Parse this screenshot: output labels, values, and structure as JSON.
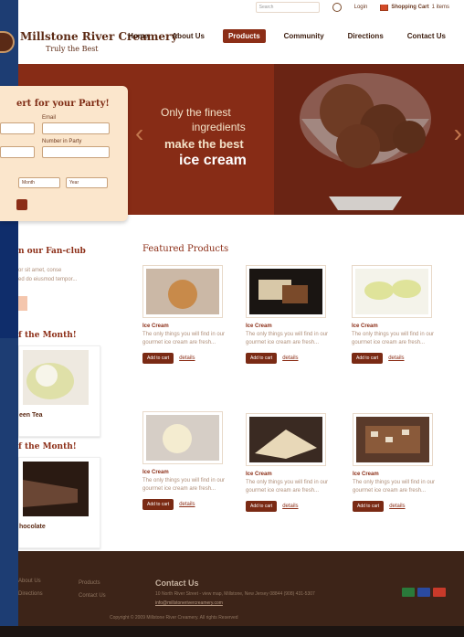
{
  "utility": {
    "search_placeholder": "Search",
    "login": "Login",
    "cart": "Shopping Cart",
    "cart_count": "1 items"
  },
  "header": {
    "brand": "Millstone River Creamery",
    "tagline": "Truly the Best",
    "nav": [
      "Home",
      "About Us",
      "Products",
      "Community",
      "Directions",
      "Contact Us"
    ],
    "active_nav": "Products"
  },
  "hero": {
    "line1": "Only the finest",
    "line2": "ingredients",
    "line3": "make the best",
    "line4": "ice cream"
  },
  "reservation": {
    "title": "ert for your Party!",
    "email_label": "Email",
    "number_label": "Number in Party",
    "month": "Month",
    "year": "Year"
  },
  "sidebar": {
    "fanclub_title": "n our Fan-club",
    "fanclub_text": [
      "or sit amet, conse",
      "ed do eiusmod tempor..."
    ],
    "month1_title": "f the Month!",
    "month1_caption": "een Tea",
    "month2_title": "f the Month!",
    "month2_caption": "hocolate"
  },
  "featured": {
    "title": "Featured Products",
    "products": [
      {
        "name": "Ice Cream",
        "desc": "The only things you will find in our gourmet ice cream are fresh..."
      },
      {
        "name": "Ice Cream",
        "desc": "The only things you will find in our gourmet ice cream are fresh..."
      },
      {
        "name": "Ice Cream",
        "desc": "The only things you will find in our gourmet ice cream are fresh..."
      },
      {
        "name": "Ice Cream",
        "desc": "The only things you will find in our gourmet ice cream are fresh..."
      },
      {
        "name": "Ice Cream",
        "desc": "The only things you will find in our gourmet ice cream are fresh..."
      },
      {
        "name": "Ice Cream",
        "desc": "The only things you will find in our gourmet ice cream are fresh..."
      }
    ],
    "add_to_cart": "Add to cart",
    "details": "details"
  },
  "footer": {
    "col1": [
      "About Us",
      "Directions"
    ],
    "col2": [
      "Products",
      "Contact Us"
    ],
    "contact_title": "Contact Us",
    "address": "10 North River Street - view map, Millstone, New Jersey 08844 (908) 431-5307",
    "email": "info@millstonerivercreamery.com",
    "copyright": "Copyright © 2009 Millstone River Creamery. All rights Reserved",
    "payment_icons": [
      "mastercard-icon",
      "visa-icon",
      "amex-icon"
    ]
  },
  "colors": {
    "brand_brown": "#5c2a14",
    "accent_red": "#8c2e17",
    "hero_bg": "#6a2414",
    "footer_bg": "#3d2418"
  }
}
